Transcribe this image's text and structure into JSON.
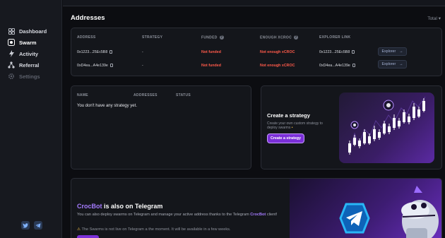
{
  "sidebar": {
    "items": [
      {
        "label": "Dashboard",
        "icon": "dashboard-icon"
      },
      {
        "label": "Swarm",
        "icon": "swarm-icon"
      },
      {
        "label": "Activity",
        "icon": "activity-icon"
      },
      {
        "label": "Referral",
        "icon": "referral-icon"
      },
      {
        "label": "Settings",
        "icon": "settings-icon"
      }
    ],
    "social": [
      "twitter-icon",
      "telegram-icon"
    ]
  },
  "addresses": {
    "title": "Addresses",
    "filter": "Total",
    "columns": [
      "ADDRESS",
      "STRATEGY",
      "FUNDED",
      "ENOUGH XCROC",
      "EXPLORER LINK"
    ],
    "rows": [
      {
        "address": "0x1223...25Ec5B8",
        "strategy": "-",
        "funded": "Not funded",
        "enough": "Not enough xCROC",
        "explorer_addr": "0x1223...25Ec5B8",
        "explorer_btn": "Explorer"
      },
      {
        "address": "0xD4ea...A4e139e",
        "strategy": "-",
        "funded": "Not funded",
        "enough": "Not enough xCROC",
        "explorer_addr": "0xD4ea...A4e139e",
        "explorer_btn": "Explorer"
      }
    ]
  },
  "strategies": {
    "columns": [
      "NAME",
      "ADDRESSES",
      "STATUS"
    ],
    "empty": "You don't have any strategy yet."
  },
  "create": {
    "title": "Create a strategy",
    "desc": "Create your own custom strategy to deploy swarms",
    "button": "Create a strategy"
  },
  "telegram": {
    "title_brand": "CrocBot",
    "title_rest": " is also on Telegram",
    "body_1": "You can also deploy swarms on Telegram and manage your active address thanks to the Telegram ",
    "body_brand": "CrocBot",
    "body_2": " client!",
    "warning": "The Swarms is not live on Telegram a the moment. It will be available in a few weeks."
  },
  "colors": {
    "accent": "#7b2fd8",
    "danger": "#ff5a4a",
    "brand": "#a57bff"
  }
}
